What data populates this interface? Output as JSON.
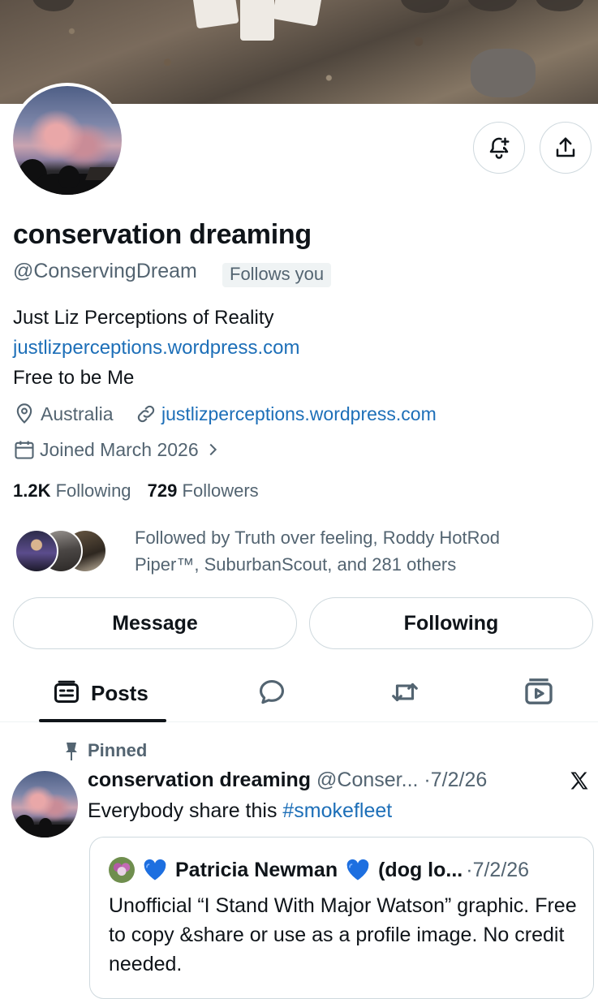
{
  "profile": {
    "display_name": "conservation dreaming",
    "handle": "@ConservingDream",
    "follows_you_badge": "Follows you",
    "bio_line1": "Just Liz Perceptions of Reality",
    "bio_link": "justlizperceptions.wordpress.com",
    "bio_line3": "Free to be Me",
    "location": "Australia",
    "website": "justlizperceptions.wordpress.com",
    "joined": "Joined March 2026",
    "following_count": "1.2K",
    "following_label": "Following",
    "followers_count": "729",
    "followers_label": "Followers",
    "followed_by": "Followed by Truth over feeling, Roddy HotRod Piper™, SuburbanScout, and 281 others"
  },
  "actions": {
    "message_label": "Message",
    "following_label": "Following"
  },
  "tabs": {
    "posts_label": "Posts"
  },
  "pinned_post": {
    "pinned_label": "Pinned",
    "author_name": "conservation dreaming",
    "author_handle": "@Conser...",
    "separator": "·",
    "date": "7/2/26",
    "text_prefix": "Everybody share this ",
    "hashtag": "#smokefleet",
    "quote": {
      "author_name": "Patricia Newman",
      "author_suffix": "(dog lo...",
      "separator": "·",
      "date": "7/2/26",
      "text": "Unofficial “I Stand With Major Watson” graphic. Free to copy &share or use as a profile image. No credit needed."
    }
  },
  "colors": {
    "link": "#1d6fb8",
    "secondary_text": "#536471",
    "border": "#cfd9de",
    "heart": "#1d6fe0"
  },
  "icons": [
    "notification-bell-plus-icon",
    "share-icon",
    "location-pin-icon",
    "link-icon",
    "calendar-icon",
    "chevron-right-icon",
    "posts-icon",
    "replies-icon",
    "reposts-icon",
    "media-icon",
    "pin-icon",
    "x-logo-icon",
    "blue-heart-icon"
  ]
}
